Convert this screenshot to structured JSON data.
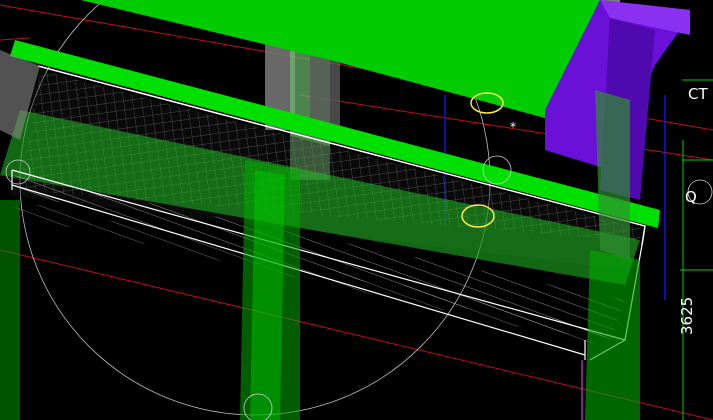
{
  "viewport": {
    "title": ""
  },
  "labels": {
    "corner_label": "CT",
    "q_label": "Q",
    "dimension": "3625"
  },
  "colors": {
    "background": "#000000",
    "beam_green": "#00e000",
    "column_green": "#2f8f2f",
    "column_gray": "#7a7a7a",
    "purple": "#6a10d8",
    "grid_red": "#c01010",
    "blue_line": "#1010ff",
    "cursor_yellow": "#ffee44",
    "wire_white": "#ffffff",
    "dim_green": "#00cc00"
  }
}
